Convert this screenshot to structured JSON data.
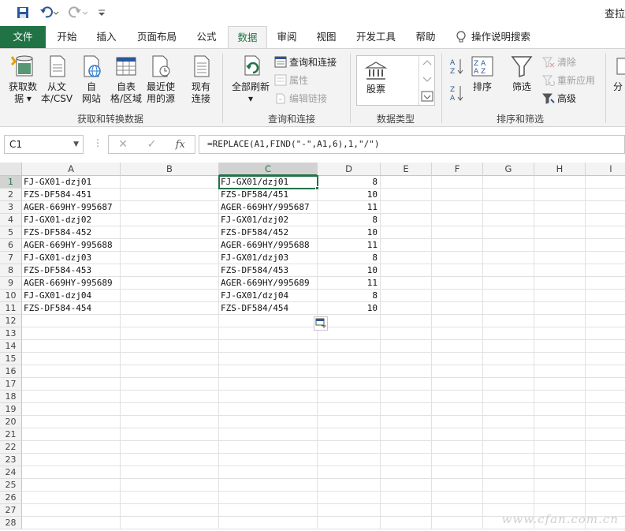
{
  "qat": {
    "title": "查拉"
  },
  "tabs": [
    "文件",
    "开始",
    "插入",
    "页面布局",
    "公式",
    "数据",
    "审阅",
    "视图",
    "开发工具",
    "帮助",
    "操作说明搜索"
  ],
  "ribbon": {
    "get_data": "获取数\n据 ▾",
    "from_csv": "从文\n本/CSV",
    "from_web": "自\n网站",
    "from_table": "自表\n格/区域",
    "recent_sources": "最近使\n用的源",
    "existing_conn": "现有\n连接",
    "refresh_all": "全部刷新\n▾",
    "queries_conn": "查询和连接",
    "properties": "属性",
    "edit_links": "编辑链接",
    "stocks": "股票",
    "sort": "排序",
    "filter": "筛选",
    "clear": "清除",
    "reapply": "重新应用",
    "advanced": "高级",
    "group_get": "获取和转换数据",
    "group_queries": "查询和连接",
    "group_types": "数据类型",
    "group_sort": "排序和筛选",
    "partial": "分"
  },
  "formula_bar": {
    "name_box": "C1",
    "formula": "=REPLACE(A1,FIND(\"-\",A1,6),1,\"/\")"
  },
  "columns": [
    "A",
    "B",
    "C",
    "D",
    "E",
    "F",
    "G",
    "H",
    "I"
  ],
  "rows": [
    {
      "n": "1",
      "a": "FJ-GX01-dzj01",
      "c": "FJ-GX01/dzj01",
      "d": "8"
    },
    {
      "n": "2",
      "a": "FZS-DF584-451",
      "c": "FZS-DF584/451",
      "d": "10"
    },
    {
      "n": "3",
      "a": "AGER-669HY-995687",
      "c": "AGER-669HY/995687",
      "d": "11"
    },
    {
      "n": "4",
      "a": "FJ-GX01-dzj02",
      "c": "FJ-GX01/dzj02",
      "d": "8"
    },
    {
      "n": "5",
      "a": "FZS-DF584-452",
      "c": "FZS-DF584/452",
      "d": "10"
    },
    {
      "n": "6",
      "a": "AGER-669HY-995688",
      "c": "AGER-669HY/995688",
      "d": "11"
    },
    {
      "n": "7",
      "a": "FJ-GX01-dzj03",
      "c": "FJ-GX01/dzj03",
      "d": "8"
    },
    {
      "n": "8",
      "a": "FZS-DF584-453",
      "c": "FZS-DF584/453",
      "d": "10"
    },
    {
      "n": "9",
      "a": "AGER-669HY-995689",
      "c": "AGER-669HY/995689",
      "d": "11"
    },
    {
      "n": "10",
      "a": "FJ-GX01-dzj04",
      "c": "FJ-GX01/dzj04",
      "d": "8"
    },
    {
      "n": "11",
      "a": "FZS-DF584-454",
      "c": "FZS-DF584/454",
      "d": "10"
    }
  ],
  "empty_rows": [
    "12",
    "13",
    "14",
    "15",
    "16",
    "17",
    "18",
    "19",
    "20",
    "21",
    "22",
    "23",
    "24",
    "25",
    "26",
    "27",
    "28"
  ],
  "watermark": "www.cfan.com.cn"
}
